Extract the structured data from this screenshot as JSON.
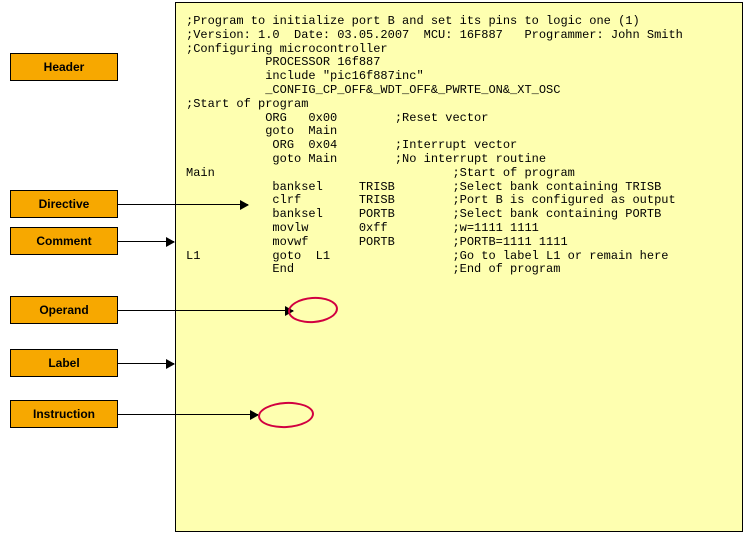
{
  "labels": {
    "header": "Header",
    "directive": "Directive",
    "comment": "Comment",
    "operand": "Operand",
    "label": "Label",
    "instruction": "Instruction"
  },
  "code": {
    "l01": ";Program to initialize port B and set its pins to logic one (1)",
    "l02": "",
    "l03": ";Version: 1.0  Date: 03.05.2007  MCU: 16F887   Programmer: John Smith",
    "l04": "",
    "l05": ";Configuring microcontroller",
    "l06": "",
    "l07": "           PROCESSOR 16f887",
    "l08": "           include \"pic16f887inc\"",
    "l09": "",
    "l10": "           _CONFIG_CP_OFF&_WDT_OFF&_PWRTE_ON&_XT_OSC",
    "l11": "",
    "l12": ";Start of program",
    "l13": "",
    "l14": "           ORG   0x00        ;Reset vector",
    "l15": "           goto  Main",
    "l16": "",
    "l17": "            ORG  0x04        ;Interrupt vector",
    "l18": "            goto Main        ;No interrupt routine",
    "l19": "",
    "l20": "Main                                 ;Start of program",
    "l21": "            banksel     TRISB        ;Select bank containing TRISB",
    "l22": "            clrf        TRISB        ;Port B is configured as output",
    "l23": "            banksel     PORTB        ;Select bank containing PORTB",
    "l24": "            movlw       0xff         ;w=1111 1111",
    "l25": "            movwf       PORTB        ;PORTB=1111 1111",
    "l26": "L1          goto  L1                 ;Go to label L1 or remain here",
    "l27": "",
    "l28": "            End                      ;End of program"
  }
}
